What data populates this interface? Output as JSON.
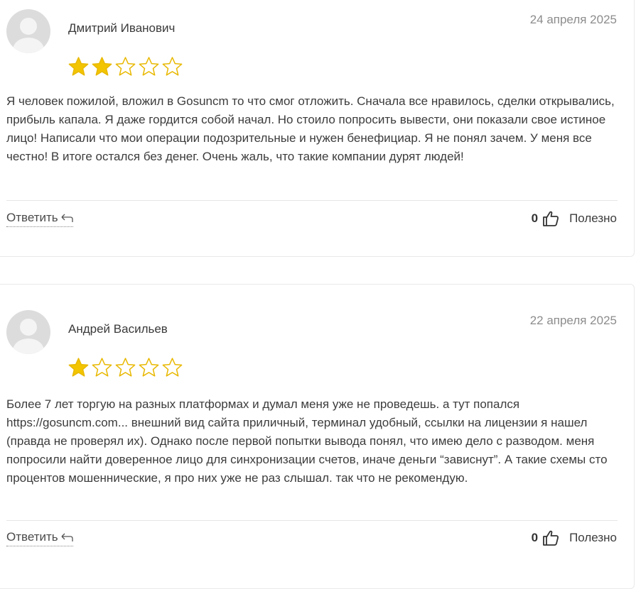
{
  "reviews": [
    {
      "author": "Дмитрий Иванович",
      "date": "24 апреля 2025",
      "rating": 2,
      "max_rating": 5,
      "text": "Я человек пожилой, вложил в Gosuncm то что смог отложить. Сначала все нравилось, сделки открывались, прибыль капала. Я даже гордится собой начал. Но стоило попросить вывести, они показали свое истиное лицо! Написали что мои операции подозрительные и нужен бенефициар. Я не понял зачем. У меня все честно! В итоге остался без денег. Очень жаль, что такие компании дурят людей!",
      "reply_label": "Ответить",
      "helpful_count": "0",
      "helpful_label": "Полезно"
    },
    {
      "author": "Андрей Васильев",
      "date": "22 апреля 2025",
      "rating": 1,
      "max_rating": 5,
      "text": "Более 7 лет торгую на разных платформах и думал меня уже не проведешь. а тут попался https://gosuncm.com... внешний вид сайта приличный, терминал удобный, ссылки на лицензии я нашел (правда не проверял их). Однако после первой попытки вывода понял, что имею дело с разводом. меня попросили найти доверенное лицо для синхронизации счетов, иначе деньги “зависнут”. А такие схемы сто процентов мошеннические, я про них уже не раз слышал. так что не рекомендую.",
      "reply_label": "Ответить",
      "helpful_count": "0",
      "helpful_label": "Полезно"
    }
  ],
  "colors": {
    "star_filled": "#f2c500",
    "star_stroke": "#e8b800",
    "date_text": "#8c8c8c"
  },
  "icons": {
    "reply": "reply-arrow-icon",
    "helpful": "thumbs-up-icon",
    "avatar": "default-avatar-icon"
  }
}
